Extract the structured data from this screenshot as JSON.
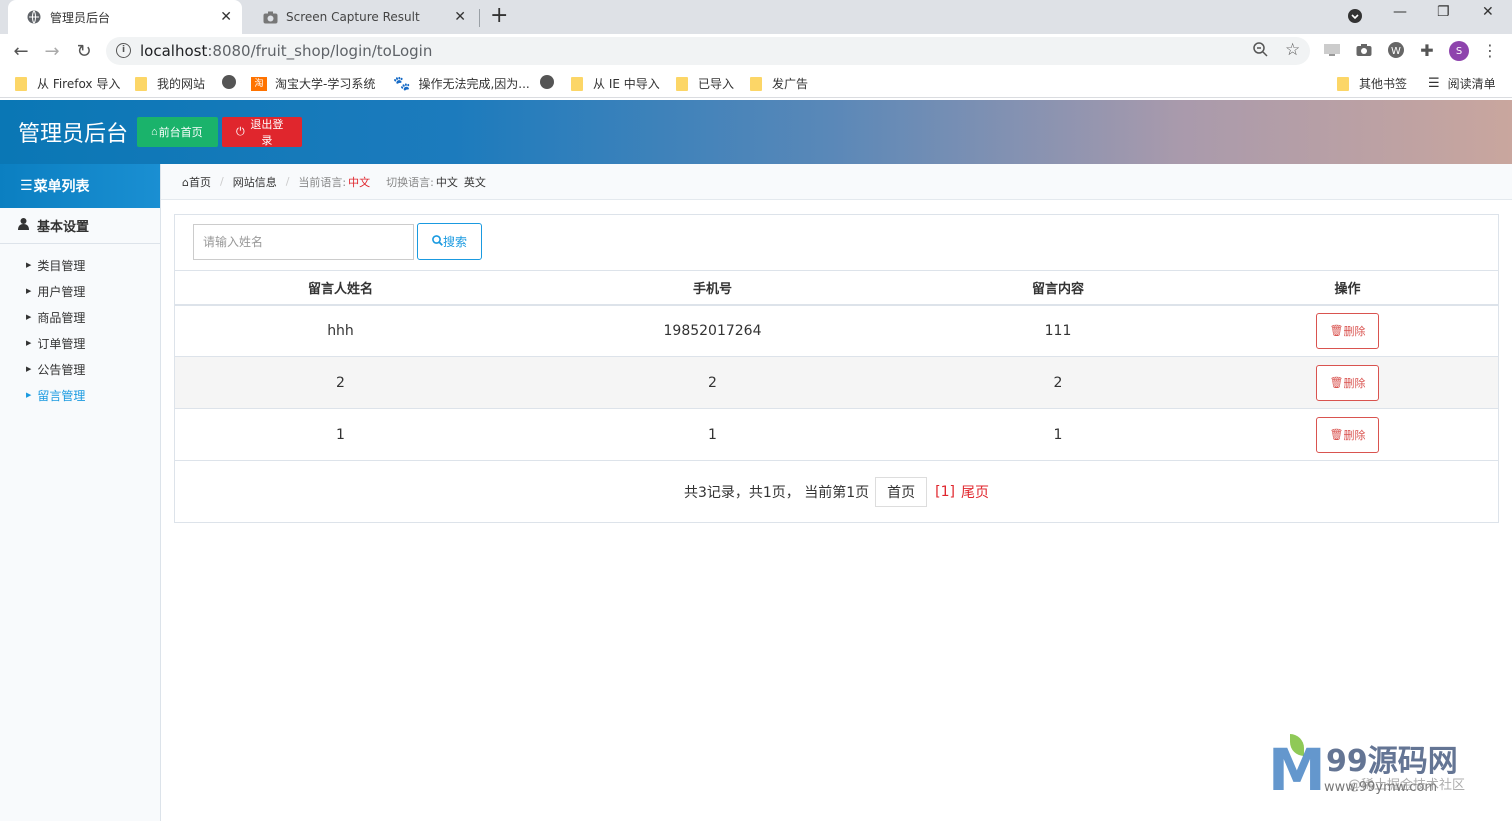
{
  "browser": {
    "tabs": [
      {
        "title": "管理员后台",
        "active": true
      },
      {
        "title": "Screen Capture Result",
        "active": false
      }
    ],
    "url_host": "localhost",
    "url_rest": ":8080/fruit_shop/login/toLogin",
    "bookmarks": [
      "从 Firefox 导入",
      "我的网站",
      "淘宝大学-学习系统",
      "操作无法完成,因为...",
      "从 IE 中导入",
      "已导入",
      "发广告",
      "其他书签",
      "阅读清单"
    ],
    "avatar_letter": "S"
  },
  "header": {
    "brand": "管理员后台",
    "front_btn": "前台首页",
    "logout_btn": "退出登录",
    "gradient_start": "#0a77b5",
    "gradient_end": "#c9a69e"
  },
  "sidebar": {
    "title": "菜单列表",
    "group": "基本设置",
    "items": [
      "类目管理",
      "用户管理",
      "商品管理",
      "订单管理",
      "公告管理",
      "留言管理"
    ],
    "active_item": "留言管理"
  },
  "breadcrumb": {
    "home": "首页",
    "site_info": "网站信息",
    "current_lang_label": "当前语言:",
    "current_lang": "中文",
    "switch_lang_label": "切换语言:",
    "lang_zh": "中文",
    "lang_en": "英文"
  },
  "search": {
    "placeholder": "请输入姓名",
    "button": "搜索"
  },
  "table": {
    "headers": [
      "留言人姓名",
      "手机号",
      "留言内容",
      "操作"
    ],
    "rows": [
      {
        "name": "hhh",
        "phone": "19852017264",
        "content": "111",
        "action": "删除"
      },
      {
        "name": "2",
        "phone": "2",
        "content": "2",
        "action": "删除"
      },
      {
        "name": "1",
        "phone": "1",
        "content": "1",
        "action": "删除"
      }
    ]
  },
  "pager": {
    "summary": "共3记录，共1页，  当前第1页",
    "first": "首页",
    "current": "[1]",
    "last": "尾页"
  },
  "watermark": {
    "brand": "99源码网",
    "subtitle": "@稀土掘金技术社区",
    "domain": "www.99ymw.com"
  },
  "colors": {
    "accent": "#1a9ae0",
    "danger": "#e0262d",
    "success": "#1ab36b"
  }
}
